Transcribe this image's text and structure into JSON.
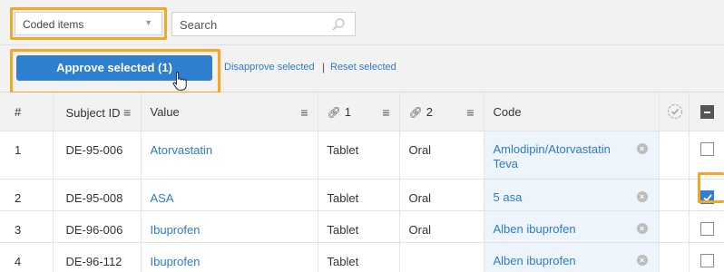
{
  "toolbar": {
    "filter_value": "Coded items",
    "search_placeholder": "Search"
  },
  "actions": {
    "approve_label": "Approve selected (1)",
    "disapprove_label": "Disapprove selected",
    "separator": "|",
    "reset_label": "Reset selected"
  },
  "columns": {
    "num": "#",
    "subject": "Subject ID",
    "value": "Value",
    "c1": "1",
    "c2": "2",
    "code": "Code"
  },
  "rows": [
    {
      "num": "1",
      "subject": "DE-95-006",
      "value": "Atorvastatin",
      "form": "Tablet",
      "route": "Oral",
      "code": "Amlodipin/Atorvastatin Teva",
      "checked": false
    },
    {
      "num": "2",
      "subject": "DE-95-008",
      "value": "ASA",
      "form": "Tablet",
      "route": "Oral",
      "code": "5 asa",
      "checked": true
    },
    {
      "num": "3",
      "subject": "DE-96-006",
      "value": "Ibuprofen",
      "form": "Tablet",
      "route": "Oral",
      "code": "Alben ibuprofen",
      "checked": false
    },
    {
      "num": "4",
      "subject": "DE-96-112",
      "value": "Ibuprofen",
      "form": "Tablet",
      "route": "",
      "code": "Alben ibuprofen",
      "checked": false
    }
  ],
  "colors": {
    "accent": "#2f7fd1",
    "link": "#2d7bc7",
    "highlight": "#f5a623",
    "code_cell_bg": "#eef4fb"
  },
  "icons": {
    "filter_arrow": "chevron-down-icon",
    "search": "search-icon",
    "column_menu": "menu-icon",
    "link_column": "link-icon",
    "clear_code": "close-icon",
    "status_header": "check-circle-icon",
    "select_all": "checkbox-indeterminate-icon",
    "cursor": "hand-pointer-icon"
  }
}
